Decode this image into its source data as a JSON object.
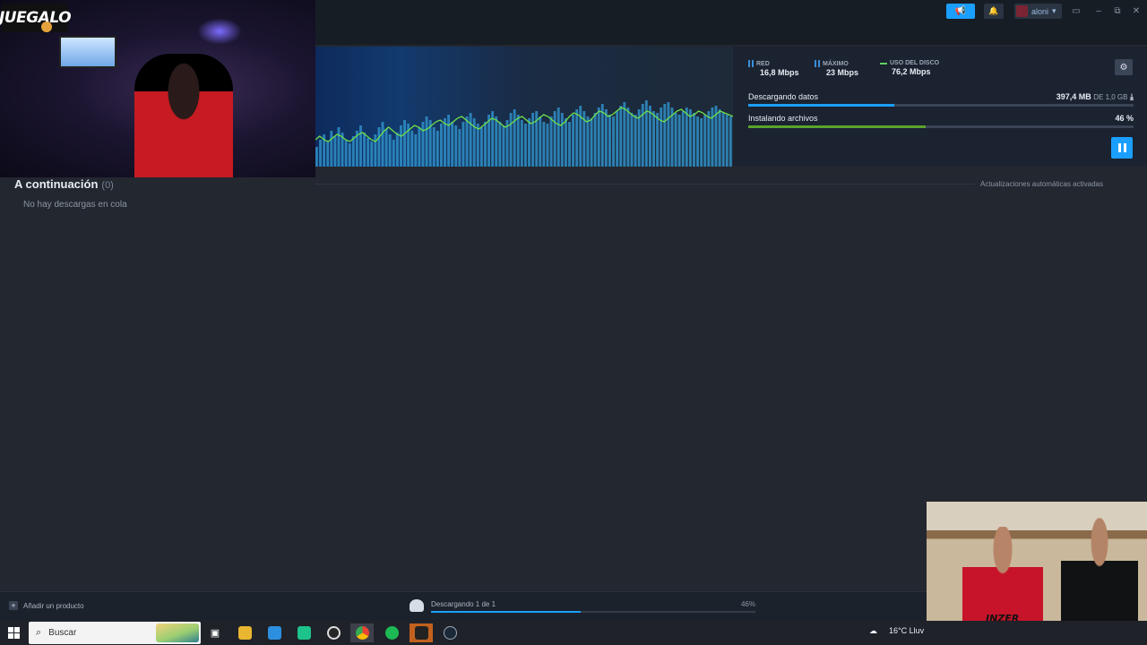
{
  "titlebar": {
    "user_name": "aloni",
    "announce_icon": "megaphone-icon",
    "bell_icon": "bell-icon"
  },
  "overlay": {
    "logo_text": "JUEGALO"
  },
  "downloads": {
    "stats": [
      {
        "label": "RED",
        "value": "16,8 Mbps",
        "icon": "bars-blue-icon"
      },
      {
        "label": "MÁXIMO",
        "value": "23 Mbps",
        "icon": "bars-blue-icon"
      },
      {
        "label": "USO DEL DISCO",
        "value": "76,2 Mbps",
        "icon": "line-green-icon"
      }
    ],
    "rows": [
      {
        "name": "Descargando datos",
        "amount": "397,4 MB",
        "amount_suffix": "DE 1,0 GB",
        "progress": 0.38,
        "color": "#1a9fff"
      },
      {
        "name": "Instalando archivos",
        "amount": "46 %",
        "amount_suffix": "",
        "progress": 0.46,
        "color": "#5ba32b"
      }
    ],
    "graph_bars": [
      22,
      30,
      36,
      28,
      40,
      34,
      44,
      38,
      30,
      26,
      34,
      40,
      46,
      38,
      32,
      28,
      36,
      44,
      50,
      42,
      36,
      30,
      38,
      46,
      52,
      48,
      40,
      36,
      44,
      50,
      56,
      52,
      44,
      40,
      48,
      54,
      58,
      50,
      46,
      42,
      50,
      56,
      60,
      54,
      48,
      44,
      50,
      58,
      62,
      56,
      50,
      46,
      52,
      60,
      64,
      58,
      52,
      48,
      54,
      60,
      62,
      56,
      50,
      48,
      56,
      62,
      66,
      60,
      54,
      50,
      58,
      64,
      68,
      62,
      56,
      54,
      60,
      66,
      70,
      64,
      58,
      56,
      62,
      68,
      72,
      66,
      60,
      58,
      64,
      70,
      74,
      68,
      62,
      60,
      66,
      70,
      72,
      66,
      60,
      58,
      62,
      66,
      64,
      60,
      56,
      54,
      58,
      62,
      66,
      68,
      64,
      60,
      58,
      56
    ],
    "graph_line": [
      30,
      34,
      30,
      28,
      32,
      36,
      34,
      30,
      28,
      32,
      36,
      38,
      34,
      30,
      28,
      34,
      40,
      44,
      40,
      36,
      34,
      38,
      42,
      46,
      44,
      40,
      42,
      46,
      50,
      52,
      48,
      46,
      50,
      54,
      56,
      52,
      48,
      44,
      42,
      46,
      50,
      54,
      52,
      48,
      44,
      46,
      50,
      54,
      56,
      52,
      48,
      50,
      54,
      58,
      56,
      52,
      48,
      46,
      50,
      56,
      60,
      58,
      54,
      50,
      52,
      58,
      62,
      60,
      56,
      58,
      62,
      66,
      64,
      60,
      56,
      54,
      58,
      62,
      60,
      56,
      52,
      50,
      54,
      58,
      62,
      64,
      60,
      56,
      58,
      62,
      60,
      56,
      54,
      58,
      62,
      60,
      58,
      56
    ],
    "settings_icon": "gear-icon",
    "pause_icon": "pause-icon"
  },
  "queue": {
    "title": "A continuación",
    "count": "(0)",
    "auto_updates": "Actualizaciones automáticas activadas",
    "empty": "No hay descargas en cola"
  },
  "footer": {
    "add_product": "Añadir un producto",
    "dl_text": "Descargando 1 de 1",
    "dl_pct": "46%",
    "dl_progress": 0.46
  },
  "taskbar": {
    "search_placeholder": "Buscar",
    "weather": "16°C Lluv",
    "icons": [
      "task-view-icon",
      "file-explorer-icon",
      "photos-icon",
      "app-green-icon",
      "obs-icon",
      "chrome-icon",
      "spotify-icon",
      "epic-games-icon",
      "steam-icon"
    ]
  },
  "cam2": {
    "shirt_text": "INZER"
  }
}
